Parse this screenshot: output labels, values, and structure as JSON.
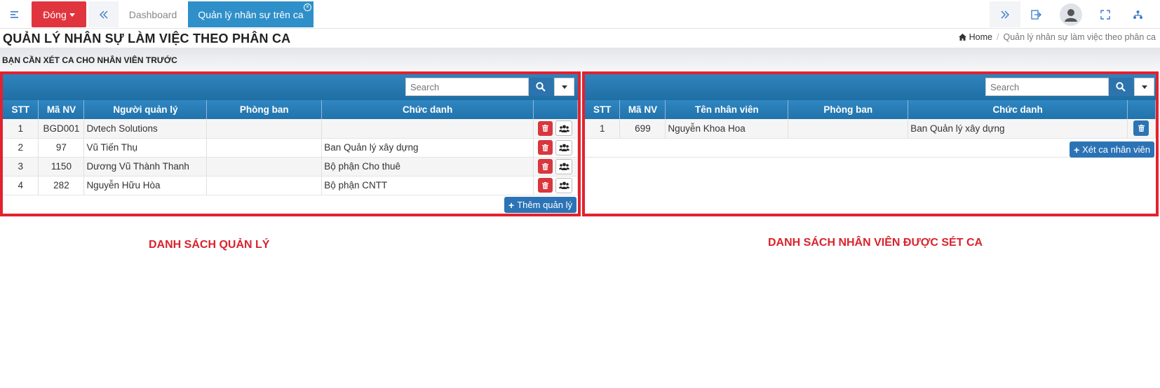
{
  "topbar": {
    "close_label": "Đóng",
    "dashboard_tab": "Dashboard",
    "active_tab": "Quản lý nhân sự trên ca",
    "close_tab_glyph": "×"
  },
  "header": {
    "title": "QUẢN LÝ NHÂN SỰ LÀM VIỆC THEO PHÂN CA",
    "breadcrumb_home": "Home",
    "breadcrumb_sep": "/",
    "breadcrumb_current": "Quản lý nhân sự làm việc theo phân ca",
    "subheading": "BẠN CẦN XÉT CA CHO NHÂN VIÊN TRƯỚC"
  },
  "left_panel": {
    "search_placeholder": "Search",
    "columns": [
      "STT",
      "Mã NV",
      "Người quản lý",
      "Phòng ban",
      "Chức danh"
    ],
    "rows": [
      {
        "stt": "1",
        "ma_nv": "BGD001",
        "name": "Dvtech Solutions",
        "dept": "",
        "title": ""
      },
      {
        "stt": "2",
        "ma_nv": "97",
        "name": "Vũ Tiến Thụ",
        "dept": "",
        "title": "Ban Quản lý xây dựng"
      },
      {
        "stt": "3",
        "ma_nv": "1150",
        "name": "Dương Vũ Thành Thanh",
        "dept": "",
        "title": "Bộ phận Cho thuê"
      },
      {
        "stt": "4",
        "ma_nv": "282",
        "name": "Nguyễn Hữu Hòa",
        "dept": "",
        "title": "Bộ phận CNTT"
      }
    ],
    "add_button": "Thêm quản lý"
  },
  "right_panel": {
    "search_placeholder": "Search",
    "columns": [
      "STT",
      "Mã NV",
      "Tên nhân viên",
      "Phòng ban",
      "Chức danh"
    ],
    "rows": [
      {
        "stt": "1",
        "ma_nv": "699",
        "name": "Nguyễn Khoa Hoa",
        "dept": "",
        "title": "Ban Quản lý xây dựng"
      }
    ],
    "add_button": "Xét ca nhân viên"
  },
  "captions": {
    "left": "DANH SÁCH QUẢN LÝ",
    "right": "DANH SÁCH NHÂN VIÊN ĐƯỢC SÉT CA"
  },
  "colors": {
    "accent": "#2e8fc9",
    "danger": "#e0353f",
    "highlight_border": "#e2222e",
    "table_header": "#2173ab"
  }
}
